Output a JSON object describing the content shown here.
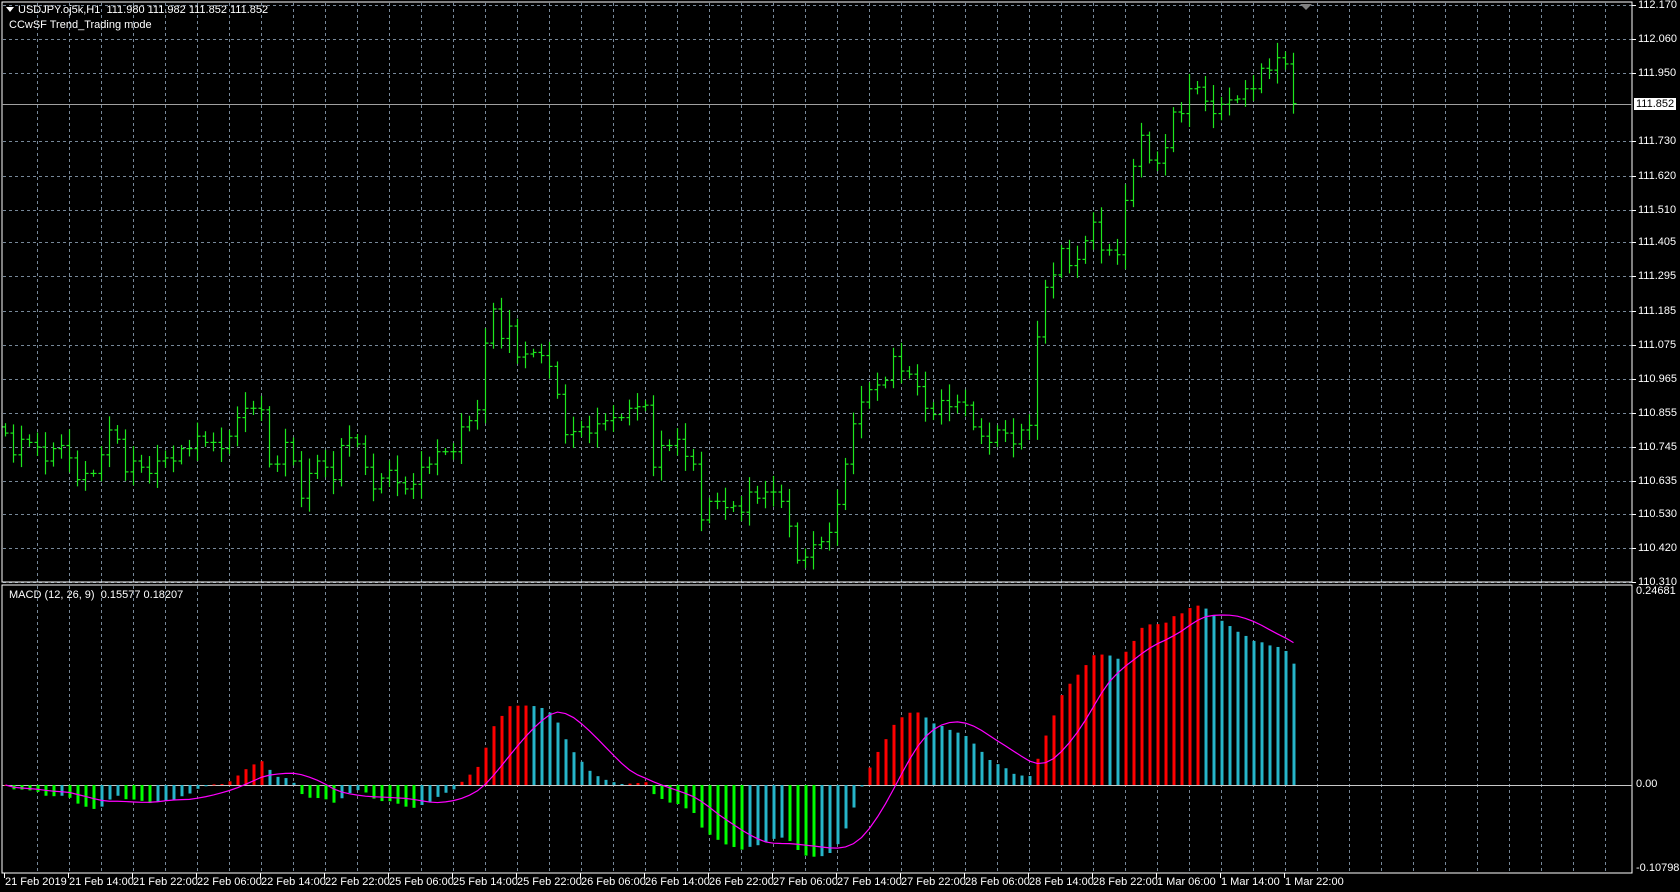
{
  "header": {
    "symbol_line": "USDJPY.oj5k,H1  111.980 111.982 111.852 111.852",
    "indicator_mode": "CCwSF Trend_Trading mode"
  },
  "macd_header": "MACD (12, 26, 9)  0.15577 0.18207",
  "colors": {
    "bars": "#1ee61e",
    "grid": "#778899",
    "hist_up": "#ff0000",
    "hist_down_neg": "#00ff00",
    "hist_pullback": "#26b5c9",
    "signal": "#ff00ff"
  },
  "chart_data": [
    {
      "type": "ohlc-bar",
      "title": "USDJPY.oj5k,H1",
      "timeframe": "H1",
      "current_price": "111.852",
      "ylim": [
        110.31,
        112.17
      ],
      "price_ticks": [
        "112.170",
        "112.060",
        "111.950",
        "111.730",
        "111.620",
        "111.510",
        "111.405",
        "111.295",
        "111.185",
        "111.075",
        "110.965",
        "110.855",
        "110.745",
        "110.635",
        "110.530",
        "110.420",
        "110.310"
      ],
      "time_labels": [
        "21 Feb 2019",
        "21 Feb 14:00",
        "21 Feb 22:00",
        "22 Feb 06:00",
        "22 Feb 14:00",
        "22 Feb 22:00",
        "25 Feb 06:00",
        "25 Feb 14:00",
        "25 Feb 22:00",
        "26 Feb 06:00",
        "26 Feb 14:00",
        "26 Feb 22:00",
        "27 Feb 06:00",
        "27 Feb 14:00",
        "27 Feb 22:00",
        "28 Feb 06:00",
        "28 Feb 14:00",
        "28 Feb 22:00",
        "1 Mar 06:00",
        "1 Mar 14:00",
        "1 Mar 22:00"
      ],
      "close": [
        110.79,
        110.72,
        110.77,
        110.76,
        110.745,
        110.7,
        110.74,
        110.75,
        110.71,
        110.64,
        110.66,
        110.66,
        110.72,
        110.8,
        110.77,
        110.665,
        110.7,
        110.68,
        110.66,
        110.7,
        110.71,
        110.7,
        110.74,
        110.74,
        110.78,
        110.76,
        110.76,
        110.74,
        110.78,
        110.84,
        110.87,
        110.87,
        110.865,
        110.69,
        110.69,
        110.76,
        110.7,
        110.58,
        110.66,
        110.7,
        110.68,
        110.64,
        110.75,
        110.775,
        110.755,
        110.68,
        110.61,
        110.645,
        110.67,
        110.63,
        110.61,
        110.625,
        110.68,
        110.69,
        110.73,
        110.73,
        110.73,
        110.81,
        110.83,
        110.865,
        111.08,
        111.19,
        111.095,
        111.135,
        111.035,
        111.045,
        111.05,
        111.04,
        111.005,
        110.915,
        110.785,
        110.795,
        110.81,
        110.79,
        110.82,
        110.83,
        110.84,
        110.84,
        110.87,
        110.875,
        110.88,
        110.68,
        110.75,
        110.75,
        110.77,
        110.715,
        110.69,
        110.51,
        110.57,
        110.57,
        110.55,
        110.555,
        110.535,
        110.6,
        110.58,
        110.6,
        110.6,
        110.57,
        110.49,
        110.38,
        110.39,
        110.43,
        110.44,
        110.47,
        110.56,
        110.69,
        110.82,
        110.89,
        110.93,
        110.945,
        110.96,
        111.037,
        110.99,
        110.98,
        110.94,
        110.87,
        110.85,
        110.895,
        110.875,
        110.89,
        110.88,
        110.81,
        110.78,
        110.76,
        110.8,
        110.79,
        110.755,
        110.8,
        110.815,
        111.1,
        111.26,
        111.3,
        111.385,
        111.33,
        111.35,
        111.41,
        111.47,
        111.38,
        111.38,
        111.365,
        111.54,
        111.65,
        111.75,
        111.67,
        111.66,
        111.71,
        111.825,
        111.82,
        111.9,
        111.905,
        111.86,
        111.82,
        111.85,
        111.864,
        111.867,
        111.9,
        111.9,
        111.966,
        111.96,
        112.0,
        111.98,
        111.852
      ]
    },
    {
      "type": "histogram+line",
      "title": "MACD (12, 26, 9)",
      "params": [
        12,
        26,
        9
      ],
      "last_main": 0.15577,
      "last_signal": 0.18207,
      "ylim": [
        -0.10798,
        0.24681
      ],
      "axis_labels": [
        "0.24681",
        "0.00",
        "-0.10798"
      ]
    }
  ]
}
